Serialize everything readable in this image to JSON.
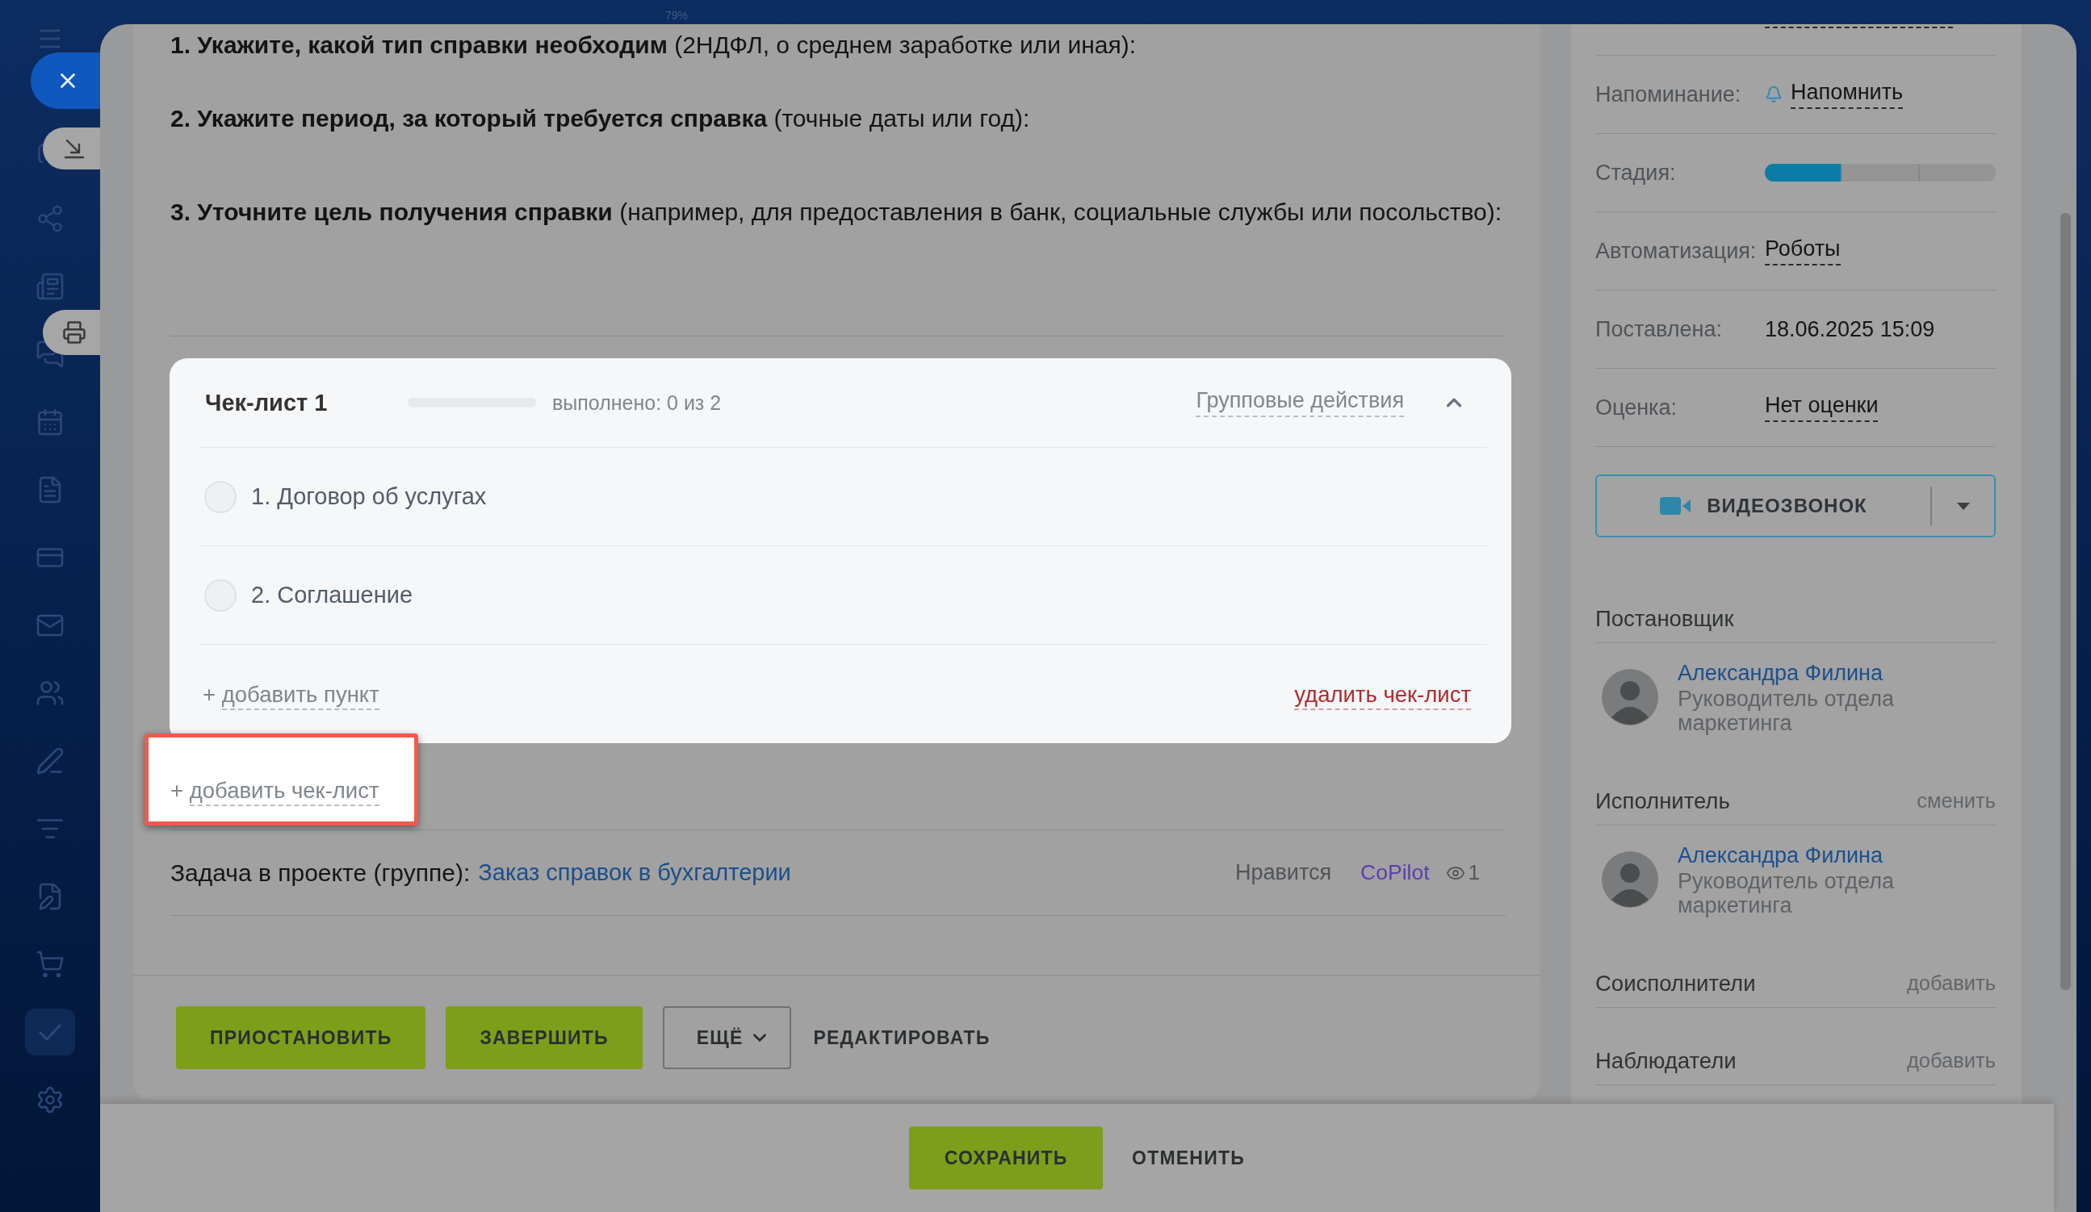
{
  "top_bar": {
    "zoom": "79%"
  },
  "description": [
    "**1. Укажите, какой тип справки необходим** (2НДФЛ, о среднем заработке или иная):",
    "**2. Укажите период, за который требуется справка** (точные даты или год):",
    "**3. Уточните цель получения справки** (например, для предоставления в банк, социальные службы или посольство):"
  ],
  "checklist": {
    "title": "Чек-лист 1",
    "highlighted": true,
    "expanded": true,
    "progress": {
      "level": 0
    },
    "progress_text": "выполнено: 0 из 2",
    "group_actions": "Групповые действия",
    "items": [
      {
        "label": "1. Договор об услугах",
        "checked": false
      },
      {
        "label": "2. Соглашение",
        "checked": false
      }
    ],
    "add_item": {
      "prefix": "+",
      "label": "добавить пункт"
    },
    "delete": "удалить чек-лист"
  },
  "add_checklist": {
    "prefix": "+",
    "label": "добавить чек-лист",
    "highlighted": true
  },
  "project": {
    "label": "Задача в проекте (группе):",
    "link": "Заказ справок в бухгалтерии",
    "like": "Нравится",
    "copilot": "CoPilot",
    "views": "1"
  },
  "actions": [
    {
      "label": "ПРИОСТАНОВИТЬ",
      "kind": "primary"
    },
    {
      "label": "ЗАВЕРШИТЬ",
      "kind": "primary"
    },
    {
      "label": "ЕЩЁ",
      "kind": "dropdown"
    },
    {
      "label": "РЕДАКТИРОВАТЬ",
      "kind": "text"
    }
  ],
  "fields": [
    {
      "label": "Напоминание:",
      "kind": "reminder",
      "value": "Напомнить"
    },
    {
      "label": "Стадия:",
      "kind": "stage",
      "stages": [
        {
          "done": true
        },
        {
          "done": false
        },
        {
          "done": false
        }
      ]
    },
    {
      "label": "Автоматизация:",
      "kind": "link",
      "value": "Роботы"
    },
    {
      "label": "Поставлена:",
      "kind": "text",
      "value": "18.06.2025 15:09"
    },
    {
      "label": "Оценка:",
      "kind": "link",
      "value": "Нет оценки"
    }
  ],
  "video_call": {
    "label": "ВИДЕОЗВОНОК"
  },
  "roles": [
    {
      "title": "Постановщик",
      "people": [
        {
          "name": "Александра Филина",
          "position": "Руководитель отдела маркетинга"
        }
      ]
    },
    {
      "title": "Исполнитель",
      "action": "сменить",
      "people": [
        {
          "name": "Александра Филина",
          "position": "Руководитель отдела маркетинга"
        }
      ]
    },
    {
      "title": "Соисполнители",
      "action": "добавить"
    },
    {
      "title": "Наблюдатели",
      "action": "добавить"
    }
  ],
  "footer": {
    "save": "СОХРАНИТЬ",
    "cancel": "ОТМЕНИТЬ"
  }
}
